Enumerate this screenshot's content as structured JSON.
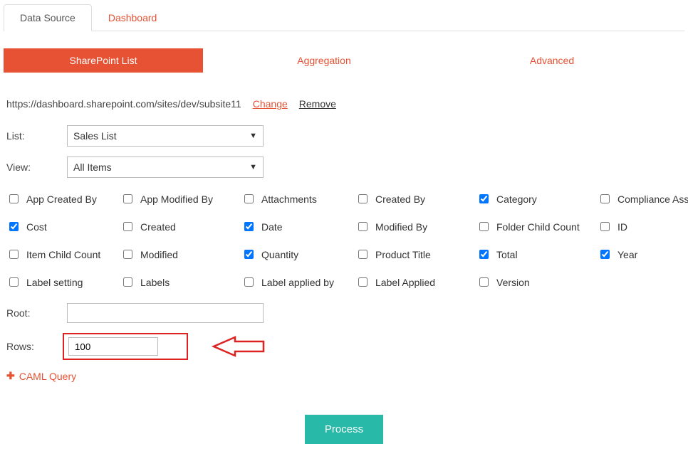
{
  "top_tabs": {
    "data_source": "Data Source",
    "dashboard": "Dashboard"
  },
  "section_tabs": {
    "sharepoint": "SharePoint List",
    "aggregation": "Aggregation",
    "advanced": "Advanced"
  },
  "url": {
    "value": "https://dashboard.sharepoint.com/sites/dev/subsite11",
    "change": "Change",
    "remove": "Remove"
  },
  "labels": {
    "list": "List:",
    "view": "View:",
    "root": "Root:",
    "rows": "Rows:"
  },
  "list_select": {
    "value": "Sales List"
  },
  "view_select": {
    "value": "All Items"
  },
  "checkboxes": {
    "r0": [
      {
        "label": "App Created By",
        "checked": false
      },
      {
        "label": "App Modified By",
        "checked": false
      },
      {
        "label": "Attachments",
        "checked": false
      },
      {
        "label": "Created By",
        "checked": false
      },
      {
        "label": "Category",
        "checked": true
      },
      {
        "label": "Compliance Asset Id",
        "checked": false
      }
    ],
    "r1": [
      {
        "label": "Cost",
        "checked": true
      },
      {
        "label": "Created",
        "checked": false
      },
      {
        "label": "Date",
        "checked": true
      },
      {
        "label": "Modified By",
        "checked": false
      },
      {
        "label": "Folder Child Count",
        "checked": false
      },
      {
        "label": "ID",
        "checked": false
      }
    ],
    "r2": [
      {
        "label": "Item Child Count",
        "checked": false
      },
      {
        "label": "Modified",
        "checked": false
      },
      {
        "label": "Quantity",
        "checked": true
      },
      {
        "label": "Product Title",
        "checked": false
      },
      {
        "label": "Total",
        "checked": true
      },
      {
        "label": "Year",
        "checked": true
      }
    ],
    "r3": [
      {
        "label": "Label setting",
        "checked": false
      },
      {
        "label": "Labels",
        "checked": false
      },
      {
        "label": "Label applied by",
        "checked": false
      },
      {
        "label": "Label Applied",
        "checked": false
      },
      {
        "label": "Version",
        "checked": false
      }
    ]
  },
  "root_input": {
    "value": ""
  },
  "rows_input": {
    "value": "100"
  },
  "caml": "CAML Query",
  "process": "Process"
}
